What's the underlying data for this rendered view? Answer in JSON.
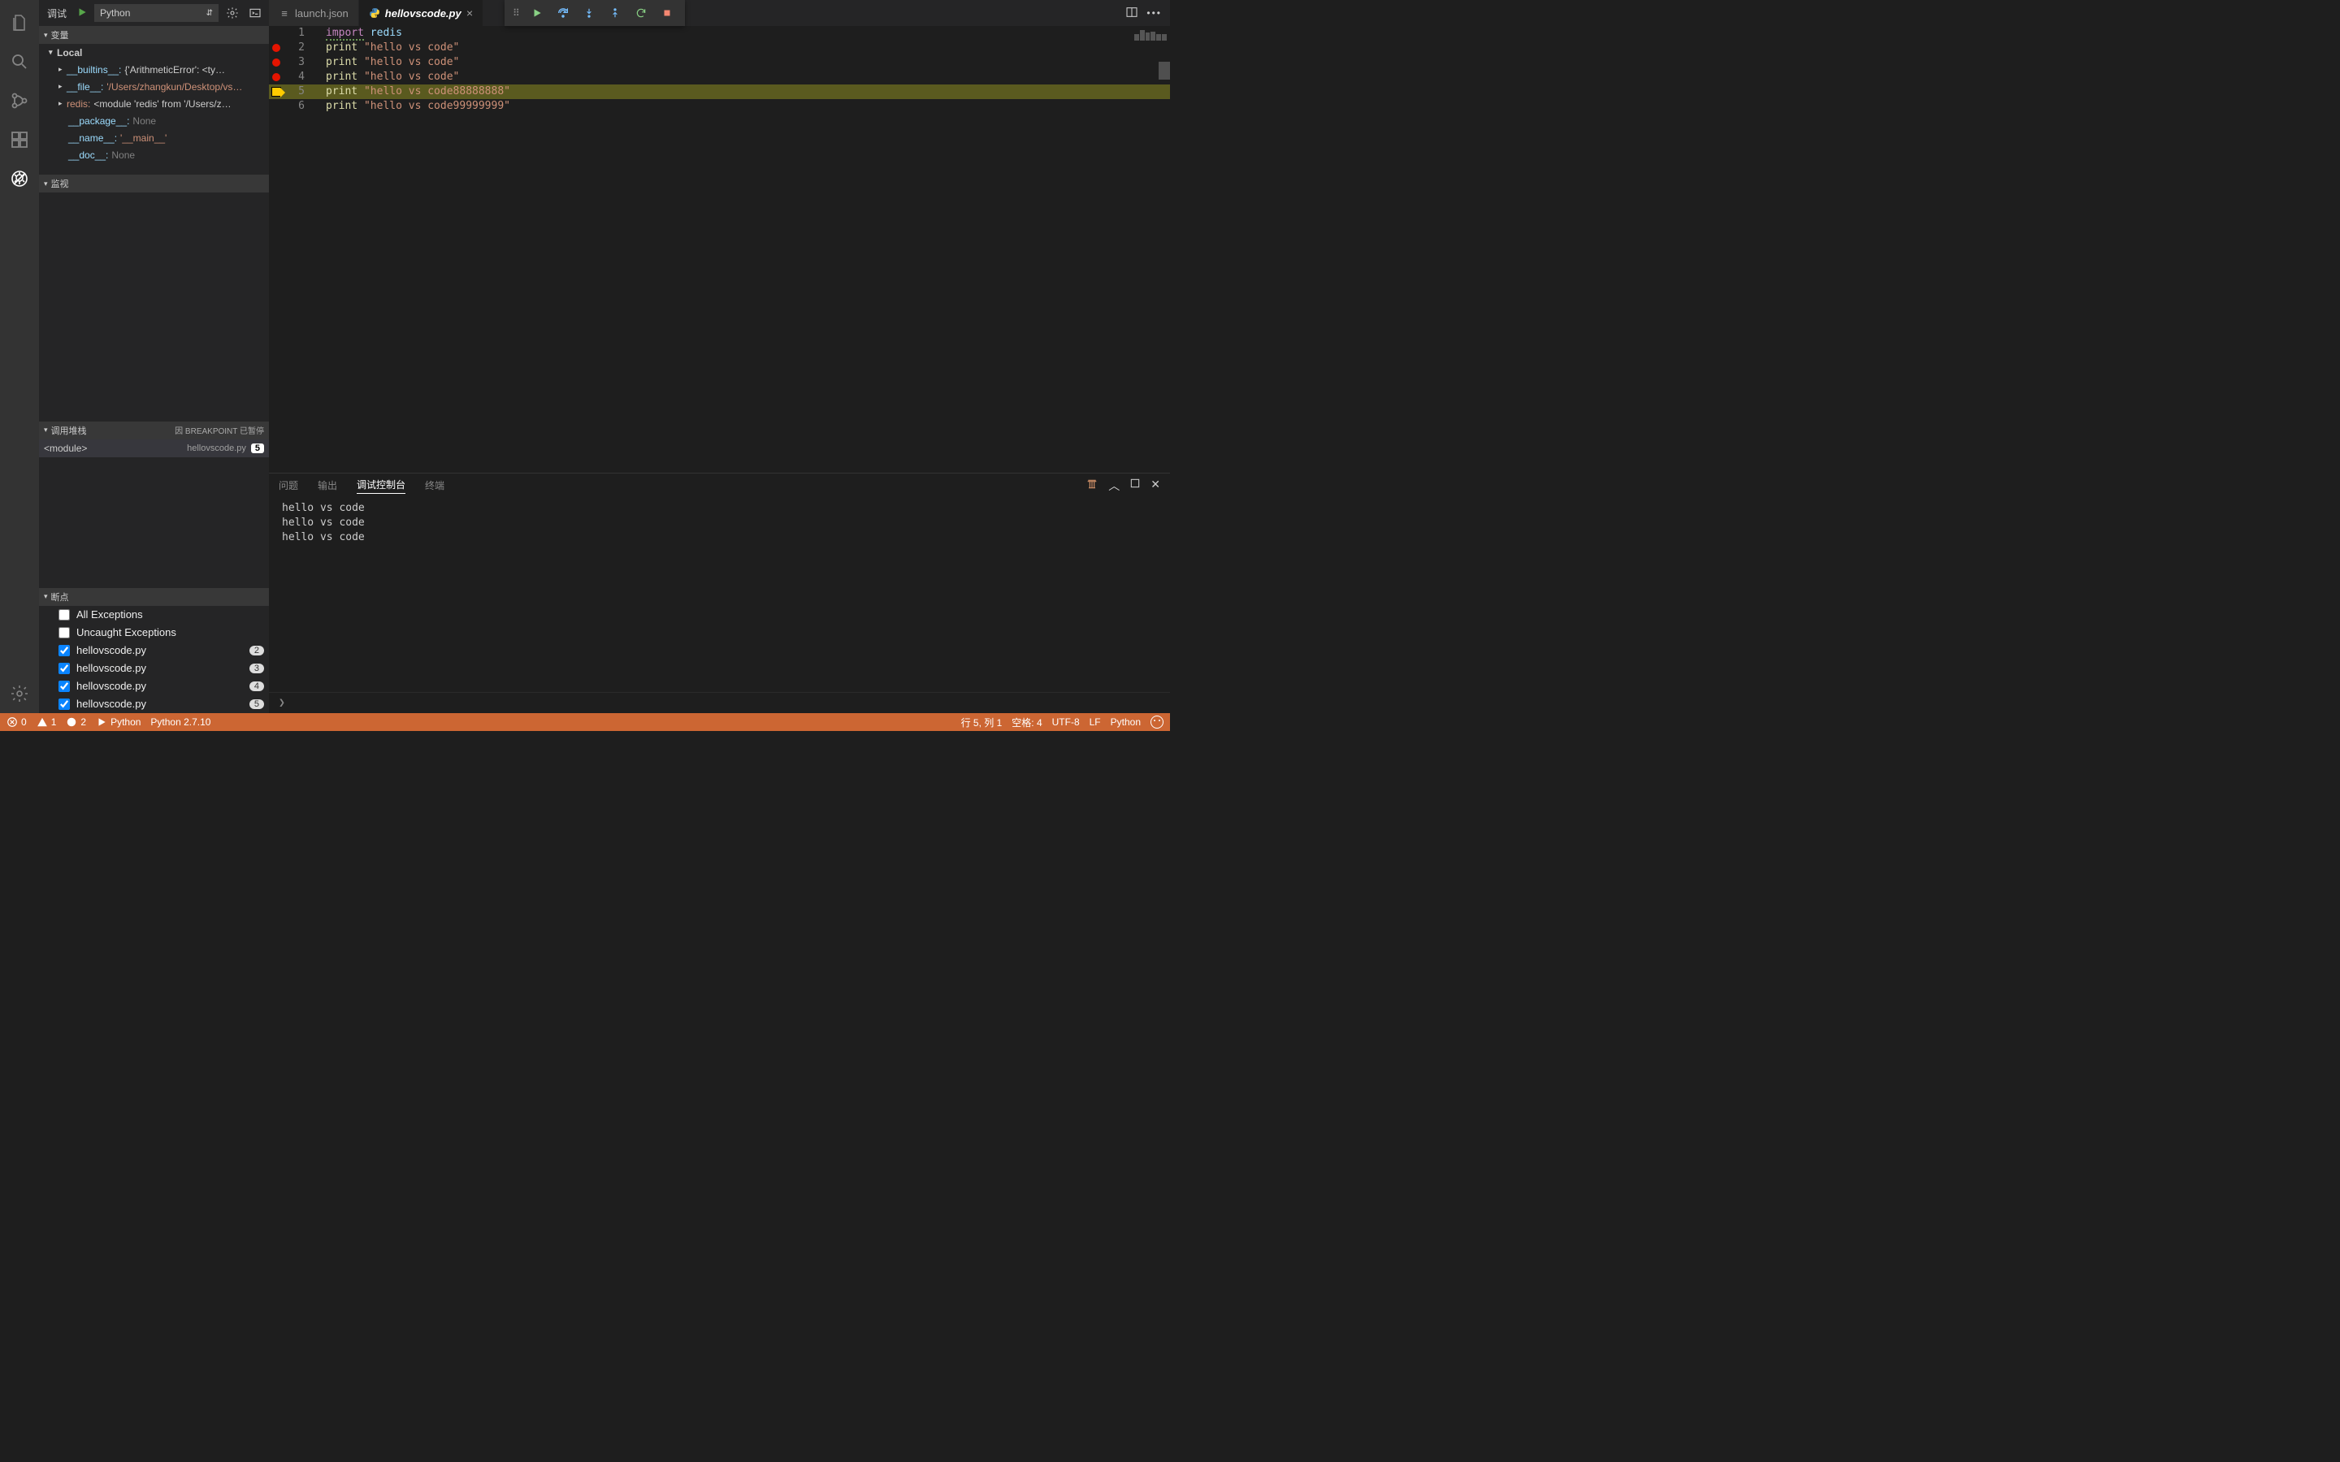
{
  "debug": {
    "title": "调试",
    "config": "Python",
    "sections": {
      "variables": "变量",
      "watch": "监视",
      "callstack": "调用堆栈",
      "breakpoints": "断点"
    },
    "scope": "Local",
    "vars": [
      {
        "k": "__builtins__:",
        "v": "{'ArithmeticError': <ty…"
      },
      {
        "k": "__file__:",
        "v": "'/Users/zhangkun/Desktop/vs…",
        "str": true
      },
      {
        "k": "redis:",
        "v": "<module 'redis' from '/Users/z…",
        "redis": true
      },
      {
        "k": "__package__:",
        "v": "None",
        "none": true
      },
      {
        "k": "__name__:",
        "v": "'__main__'",
        "str": true
      },
      {
        "k": "__doc__:",
        "v": "None",
        "none": true
      }
    ],
    "callstack_status": "因 BREAKPOINT 已暂停",
    "stack": {
      "fn": "<module>",
      "file": "hellovscode.py",
      "line": "5"
    },
    "bp_all": "All Exceptions",
    "bp_uncaught": "Uncaught Exceptions",
    "bps": [
      {
        "file": "hellovscode.py",
        "line": "2"
      },
      {
        "file": "hellovscode.py",
        "line": "3"
      },
      {
        "file": "hellovscode.py",
        "line": "4"
      },
      {
        "file": "hellovscode.py",
        "line": "5"
      }
    ]
  },
  "tabs": [
    {
      "name": "launch.json"
    },
    {
      "name": "hellovscode.py",
      "active": true
    }
  ],
  "editor": {
    "lines": [
      {
        "n": "1",
        "bp": false,
        "tokens": [
          [
            "kw",
            "import"
          ],
          [
            "plain",
            " "
          ],
          [
            "id",
            "redis"
          ]
        ],
        "sq": false
      },
      {
        "n": "2",
        "bp": true,
        "tokens": [
          [
            "fn",
            "print"
          ],
          [
            "plain",
            " "
          ],
          [
            "str",
            "\"hello vs code\""
          ]
        ]
      },
      {
        "n": "3",
        "bp": true,
        "tokens": [
          [
            "fn",
            "print"
          ],
          [
            "plain",
            " "
          ],
          [
            "str",
            "\"hello vs code\""
          ]
        ]
      },
      {
        "n": "4",
        "bp": true,
        "tokens": [
          [
            "fn",
            "print"
          ],
          [
            "plain",
            " "
          ],
          [
            "str",
            "\"hello vs code\""
          ]
        ]
      },
      {
        "n": "5",
        "bp": "cur",
        "tokens": [
          [
            "fn",
            "print"
          ],
          [
            "plain",
            " "
          ],
          [
            "str",
            "\"hello vs code88888888\""
          ]
        ],
        "current": true
      },
      {
        "n": "6",
        "bp": false,
        "tokens": [
          [
            "fn",
            "print"
          ],
          [
            "plain",
            " "
          ],
          [
            "str",
            "\"hello vs code99999999\""
          ]
        ]
      }
    ]
  },
  "panel": {
    "tabs": {
      "problems": "问题",
      "output": "输出",
      "debug_console": "调试控制台",
      "terminal": "终端"
    },
    "out": [
      "hello vs code",
      "hello vs code",
      "hello vs code"
    ],
    "prompt": "❯"
  },
  "status": {
    "errors": "0",
    "warnings": "1",
    "infos": "2",
    "run": "Python",
    "interp": "Python 2.7.10",
    "cursor": "行 5,  列 1",
    "spaces": "空格: 4",
    "encoding": "UTF-8",
    "eol": "LF",
    "lang": "Python"
  }
}
